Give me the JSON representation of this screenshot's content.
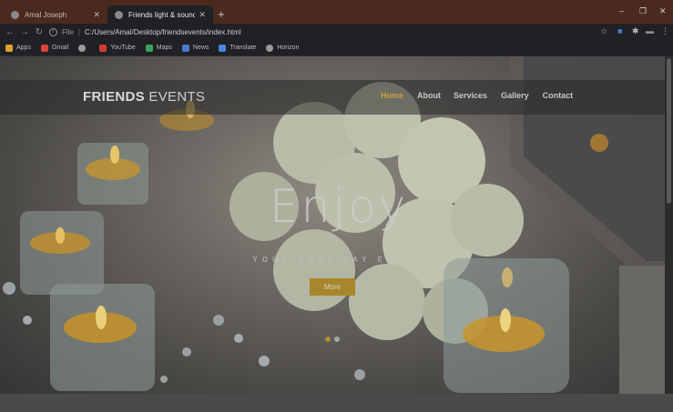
{
  "browser": {
    "tabs": [
      {
        "title": "Amal Joseph",
        "active": false
      },
      {
        "title": "Friends light & sound",
        "active": true
      }
    ],
    "new_tab_symbol": "+",
    "window_controls": [
      "–",
      "❐",
      "✕"
    ],
    "address": {
      "scheme_label": "File",
      "url": "C:/Users/Amal/Desktop/friendsevents/index.html"
    },
    "bookmarks": [
      {
        "label": "Apps",
        "icon": "apps-grid-icon",
        "color": "#e0a030"
      },
      {
        "label": "Gmail",
        "icon": "gmail-icon",
        "color": "#d9453a"
      },
      {
        "label": "",
        "icon": "globe-icon",
        "color": "#9a9a9a"
      },
      {
        "label": "YouTube",
        "icon": "youtube-icon",
        "color": "#d63b30"
      },
      {
        "label": "Maps",
        "icon": "maps-icon",
        "color": "#3aa35a"
      },
      {
        "label": "News",
        "icon": "news-icon",
        "color": "#4a7ad0"
      },
      {
        "label": "Translate",
        "icon": "translate-icon",
        "color": "#4a85e0"
      },
      {
        "label": "Horizon",
        "icon": "globe-icon",
        "color": "#9a9a9a"
      }
    ]
  },
  "site": {
    "brand_bold": "FRIENDS",
    "brand_rest": " EVENTS",
    "menu": [
      {
        "label": "Home",
        "active": true
      },
      {
        "label": "About",
        "active": false
      },
      {
        "label": "Services",
        "active": false
      },
      {
        "label": "Gallery",
        "active": false
      },
      {
        "label": "Contact",
        "active": false
      }
    ],
    "hero_title": "Enjoy",
    "hero_subtitle": "YOUR BEST DAY EVER",
    "cta_label": "More",
    "slides": [
      {
        "active": true
      },
      {
        "active": false
      }
    ],
    "colors": {
      "accent": "#c9a23a",
      "button": "#a8862c",
      "overlay": "rgba(40,40,40,0.55)"
    }
  }
}
